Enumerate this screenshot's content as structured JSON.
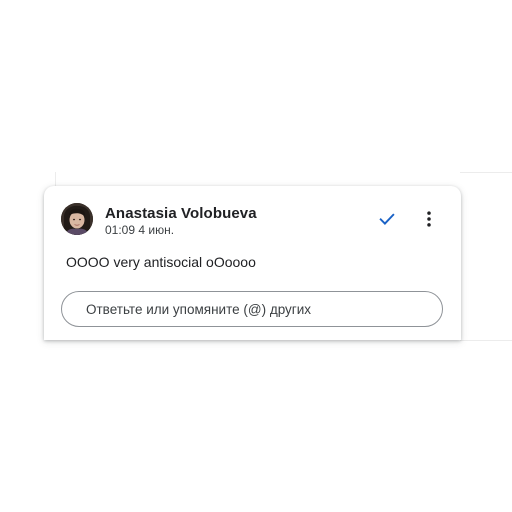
{
  "comment": {
    "author": "Anastasia Volobueva",
    "timestamp": "01:09 4 июн.",
    "text": "OOOO very antisocial oOoooo",
    "avatar_icon": "user-avatar"
  },
  "actions": {
    "resolve_icon": "checkmark-icon",
    "more_icon": "more-vert-icon"
  },
  "reply": {
    "placeholder": "Ответьте или упомяните (@) других",
    "value": ""
  },
  "colors": {
    "accent": "#1a62c6",
    "text_primary": "#202124",
    "text_secondary": "#3c4043",
    "input_border": "#8f9398"
  }
}
